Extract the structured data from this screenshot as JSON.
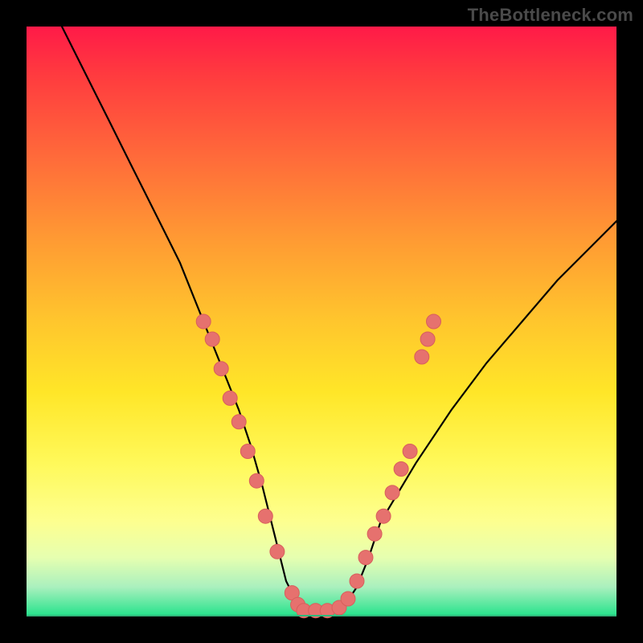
{
  "watermark": "TheBottleneck.com",
  "colors": {
    "curve_stroke": "#000000",
    "marker_fill": "#e6716e",
    "marker_stroke": "#d85f5c",
    "floor_line": "#2fb97c"
  },
  "chart_data": {
    "type": "line",
    "title": "",
    "xlabel": "",
    "ylabel": "",
    "xlim": [
      0,
      100
    ],
    "ylim": [
      0,
      100
    ],
    "series": [
      {
        "name": "bottleneck-curve",
        "x": [
          6,
          8,
          10,
          12,
          14,
          16,
          18,
          20,
          22,
          24,
          26,
          28,
          30,
          32,
          34,
          36,
          38,
          40,
          42,
          44,
          46,
          48,
          50,
          52,
          54,
          56,
          58,
          60,
          66,
          72,
          78,
          84,
          90,
          96,
          100
        ],
        "y": [
          100,
          96,
          92,
          88,
          84,
          80,
          76,
          72,
          68,
          64,
          60,
          55,
          50,
          45,
          40,
          35,
          29,
          22,
          14,
          6,
          2,
          1,
          1,
          1,
          2,
          5,
          10,
          16,
          26,
          35,
          43,
          50,
          57,
          63,
          67
        ]
      }
    ],
    "markers": [
      {
        "x": 30,
        "y": 50
      },
      {
        "x": 31.5,
        "y": 47
      },
      {
        "x": 33,
        "y": 42
      },
      {
        "x": 34.5,
        "y": 37
      },
      {
        "x": 36,
        "y": 33
      },
      {
        "x": 37.5,
        "y": 28
      },
      {
        "x": 39,
        "y": 23
      },
      {
        "x": 40.5,
        "y": 17
      },
      {
        "x": 42.5,
        "y": 11
      },
      {
        "x": 45,
        "y": 4
      },
      {
        "x": 46,
        "y": 2
      },
      {
        "x": 47,
        "y": 1
      },
      {
        "x": 49,
        "y": 1
      },
      {
        "x": 51,
        "y": 1
      },
      {
        "x": 53,
        "y": 1.5
      },
      {
        "x": 54.5,
        "y": 3
      },
      {
        "x": 56,
        "y": 6
      },
      {
        "x": 57.5,
        "y": 10
      },
      {
        "x": 59,
        "y": 14
      },
      {
        "x": 60.5,
        "y": 17
      },
      {
        "x": 62,
        "y": 21
      },
      {
        "x": 63.5,
        "y": 25
      },
      {
        "x": 65,
        "y": 28
      },
      {
        "x": 67,
        "y": 44
      },
      {
        "x": 68,
        "y": 47
      },
      {
        "x": 69,
        "y": 50
      }
    ]
  }
}
